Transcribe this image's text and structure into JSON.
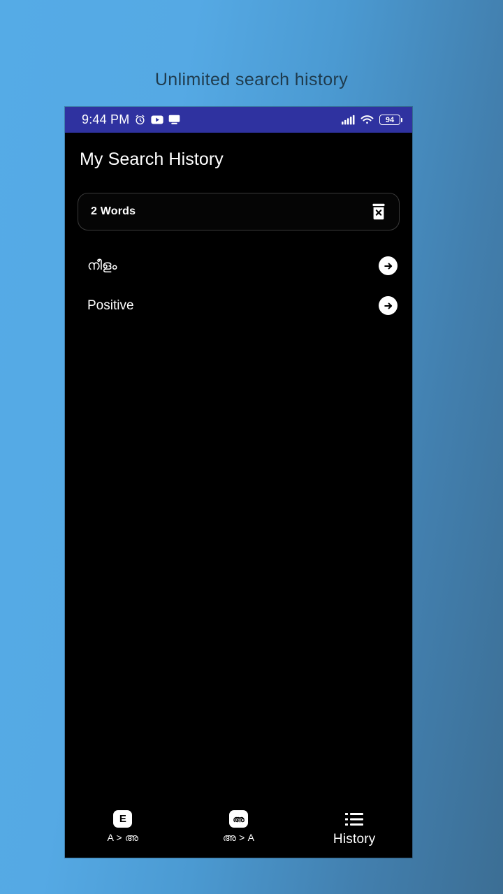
{
  "promo": {
    "caption": "Unlimited search history"
  },
  "status_bar": {
    "time": "9:44 PM",
    "battery_level": "94",
    "icons": [
      "alarm-icon",
      "youtube-icon",
      "cast-icon",
      "signal-icon",
      "wifi-icon",
      "battery-icon"
    ],
    "background_color": "#2f32a0"
  },
  "app": {
    "title": "My Search History",
    "background_color": "#000000",
    "summary": {
      "count_label": "2 Words",
      "clear_icon": "trash-delete-icon"
    },
    "history": [
      {
        "word": "നീളം",
        "action_icon": "arrow-right-icon"
      },
      {
        "word": "Positive",
        "action_icon": "arrow-right-icon"
      }
    ],
    "bottom_nav": {
      "active_index": 2,
      "items": [
        {
          "chip": "E",
          "label": "A > അ",
          "icon": "english-to-malayalam-icon"
        },
        {
          "chip": "അ",
          "label": "അ > A",
          "icon": "malayalam-to-english-icon"
        },
        {
          "chip": "",
          "label": "History",
          "icon": "list-icon"
        }
      ]
    }
  }
}
